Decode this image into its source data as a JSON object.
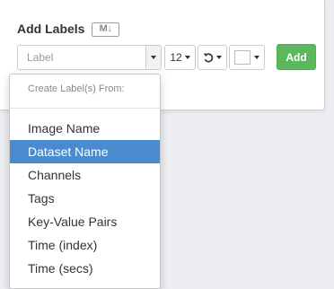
{
  "panel": {
    "title": "Add Labels",
    "markdown_badge": "M↓"
  },
  "controls": {
    "label_placeholder": "Label",
    "size_value": "12",
    "rotate_icon": "rotate-ccw-icon",
    "color_value": "#ffffff",
    "add_label": "Add"
  },
  "menu": {
    "header": "Create Label(s) From:",
    "items": [
      {
        "label": "Image Name",
        "active": false
      },
      {
        "label": "Dataset Name",
        "active": true
      },
      {
        "label": "Channels",
        "active": false
      },
      {
        "label": "Tags",
        "active": false
      },
      {
        "label": "Key-Value Pairs",
        "active": false
      },
      {
        "label": "Time (index)",
        "active": false
      },
      {
        "label": "Time (secs)",
        "active": false
      }
    ]
  },
  "colors": {
    "accent_highlight": "#4a8bd0",
    "add_button": "#5cb85c",
    "page_background": "#eceef2"
  }
}
